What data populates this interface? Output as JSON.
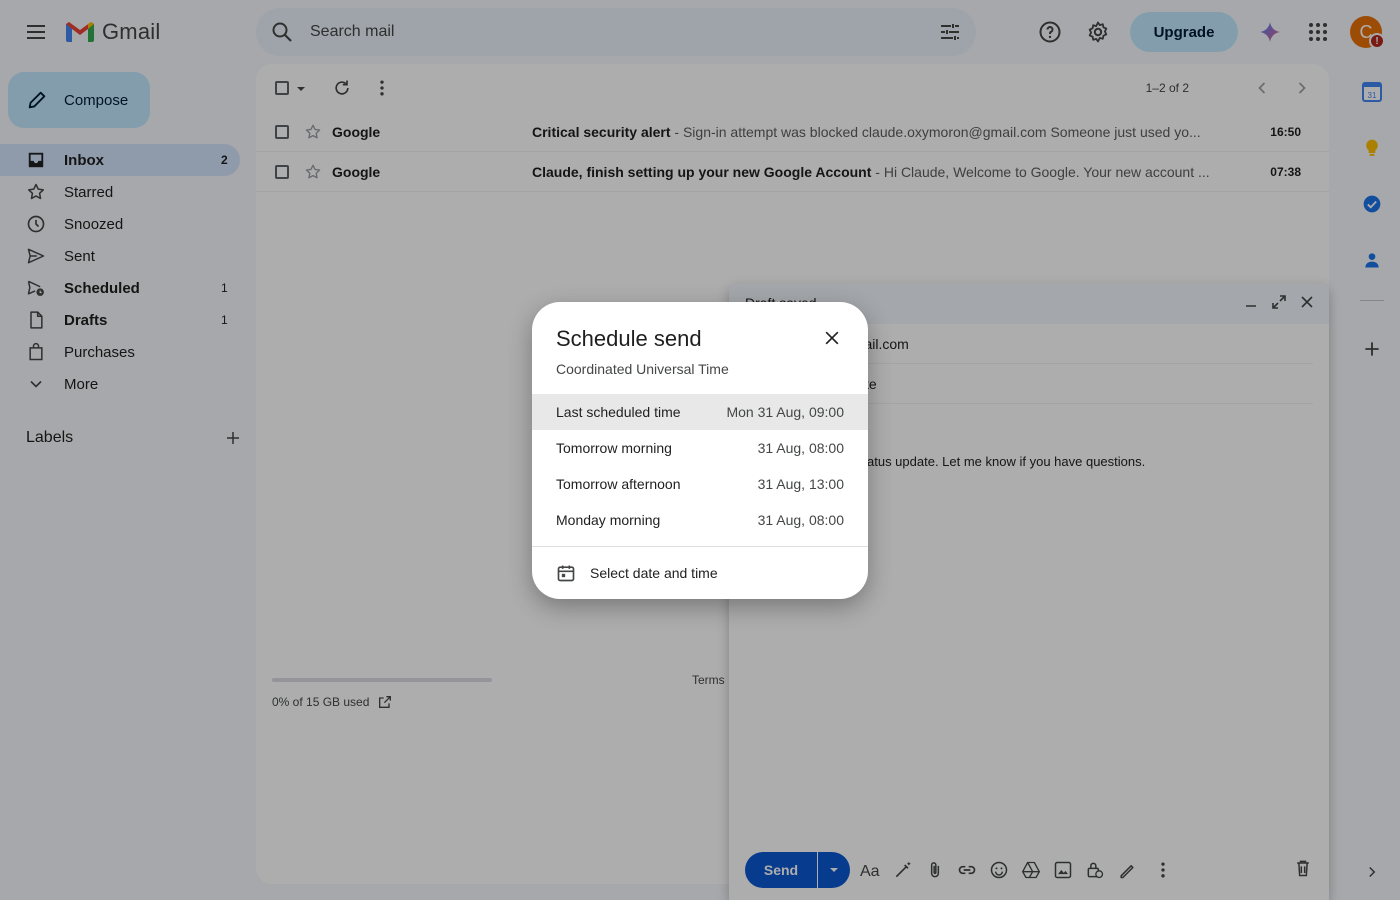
{
  "app": {
    "name": "Gmail"
  },
  "search": {
    "placeholder": "Search mail"
  },
  "header": {
    "upgrade_label": "Upgrade",
    "avatar_letter": "C",
    "avatar_badge": "!"
  },
  "sidebar": {
    "compose_label": "Compose",
    "items": [
      {
        "label": "Inbox",
        "count": "2",
        "icon": "inbox-icon"
      },
      {
        "label": "Starred",
        "count": "",
        "icon": "star-icon"
      },
      {
        "label": "Snoozed",
        "count": "",
        "icon": "clock-icon"
      },
      {
        "label": "Sent",
        "count": "",
        "icon": "send-icon"
      },
      {
        "label": "Scheduled",
        "count": "1",
        "icon": "schedule-icon"
      },
      {
        "label": "Drafts",
        "count": "1",
        "icon": "draft-icon"
      },
      {
        "label": "Purchases",
        "count": "",
        "icon": "bag-icon"
      },
      {
        "label": "More",
        "count": "",
        "icon": "chevron-down-icon"
      }
    ],
    "labels_heading": "Labels"
  },
  "mail_list": {
    "pager": "1–2 of 2",
    "rows": [
      {
        "sender": "Google",
        "subject": "Critical security alert",
        "snippet": " - Sign-in attempt was blocked claude.oxymoron@gmail.com Someone just used yo...",
        "time": "16:50"
      },
      {
        "sender": "Google",
        "subject": "Claude, finish setting up your new Google Account",
        "snippet": " - Hi Claude, Welcome to Google. Your new account ...",
        "time": "07:38"
      }
    ],
    "storage": "0% of 15 GB used",
    "storage_fraction": 0,
    "terms": "Terms"
  },
  "compose_window": {
    "title": "Draft saved",
    "to_visible": "gmail.com",
    "subject_visible": "te",
    "body_visible": "atus update. Let me know if you have questions.",
    "send_label": "Send"
  },
  "schedule_modal": {
    "title": "Schedule send",
    "timezone": "Coordinated Universal Time",
    "options": [
      {
        "label": "Last scheduled time",
        "time": "Mon 31 Aug, 09:00"
      },
      {
        "label": "Tomorrow morning",
        "time": "31 Aug, 08:00"
      },
      {
        "label": "Tomorrow afternoon",
        "time": "31 Aug, 13:00"
      },
      {
        "label": "Monday morning",
        "time": "31 Aug, 08:00"
      }
    ],
    "pick_label": "Select date and time"
  },
  "colors": {
    "accent": "#0b57d0",
    "compose_bg": "#c2e7ff",
    "active_nav": "#d3e3fd",
    "avatar": "#e8710a"
  }
}
